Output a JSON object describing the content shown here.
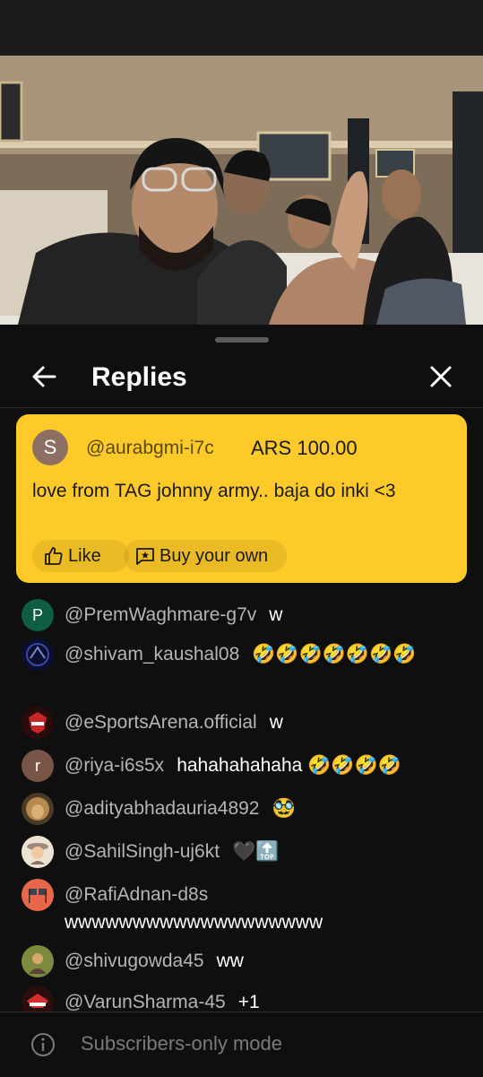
{
  "header": {
    "title": "Replies"
  },
  "super_chat": {
    "avatar_letter": "S",
    "author": "@aurabgmi-i7c",
    "amount": "ARS 100.00",
    "message": "love from TAG johnny army.. baja do inki <3",
    "like_label": "Like",
    "buy_label": "Buy your own",
    "color": "#fdca29"
  },
  "messages": [
    {
      "author": "@PremWaghmare-g7v",
      "text": "w",
      "avatar": "P"
    },
    {
      "author": "@shivam_kaushal08",
      "text": "🤣🤣🤣🤣🤣🤣🤣",
      "avatar": ""
    },
    {
      "author": "@eSportsArena.official",
      "text": "w",
      "avatar": ""
    },
    {
      "author": "@riya-i6s5x",
      "text": "hahahahahaha 🤣🤣🤣🤣",
      "avatar": "r"
    },
    {
      "author": "@adityabhadauria4892",
      "text": "🥸",
      "avatar": ""
    },
    {
      "author": "@SahilSingh-uj6kt",
      "text": "🖤🔝",
      "avatar": ""
    },
    {
      "author": "@RafiAdnan-d8s",
      "text": "wwwwwwwwwwwwwwwwwww",
      "avatar": ""
    },
    {
      "author": "@shivugowda45",
      "text": "ww",
      "avatar": ""
    },
    {
      "author": "@VarunSharma-45",
      "text": "+1",
      "avatar": ""
    }
  ],
  "footer": {
    "text": "Subscribers-only mode"
  }
}
